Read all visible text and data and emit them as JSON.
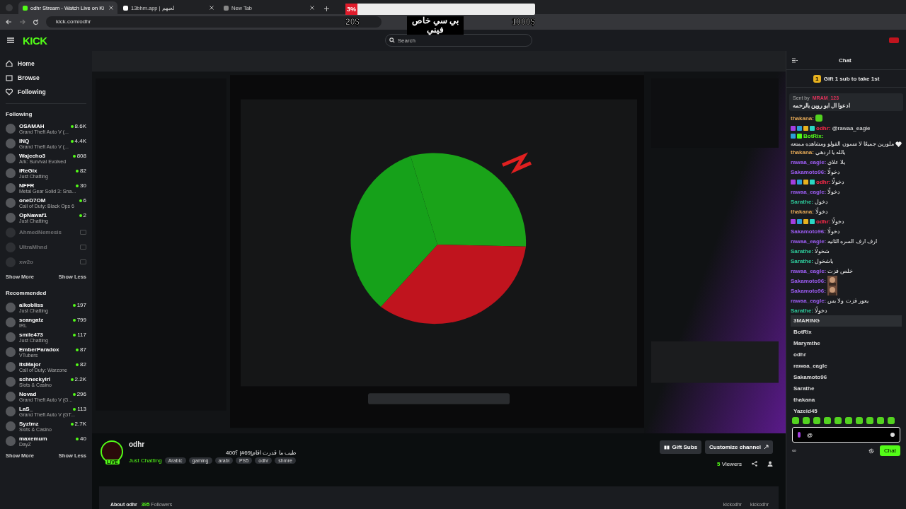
{
  "browser": {
    "tabs": [
      {
        "title": "odhr Stream - Watch Live on Ki",
        "selected": true,
        "kind": "kick"
      },
      {
        "title": "13bhm.app | لعبهم",
        "selected": false,
        "kind": "app"
      },
      {
        "title": "New Tab",
        "selected": false,
        "kind": "chrome"
      }
    ],
    "url": "kick.com/odhr"
  },
  "overlay": {
    "percent": "3%",
    "level": 0.03,
    "min": "20$",
    "max": "1000$",
    "caption": "بي سي خاص فيني"
  },
  "header": {
    "logo": "KICK",
    "search": {
      "placeholder": "Search"
    }
  },
  "sidebar": {
    "nav": [
      {
        "label": "Home",
        "kind": "home"
      },
      {
        "label": "Browse",
        "kind": "browse"
      },
      {
        "label": "Following",
        "kind": "heart"
      }
    ],
    "following_title": "Following",
    "following": [
      {
        "name": "OSAMAH",
        "game": "Grand Theft Auto V (...",
        "viewers": "8.6K",
        "live": true
      },
      {
        "name": "INQ",
        "game": "Grand Theft Auto V (...",
        "viewers": "4.4K",
        "live": true
      },
      {
        "name": "Wajeeho3",
        "game": "Ark: Survival Evolved",
        "viewers": "808",
        "live": true
      },
      {
        "name": "iReGix",
        "game": "Just Chatting",
        "viewers": "82",
        "live": true
      },
      {
        "name": "NFFR",
        "game": "Metal Gear Solid 3: Sna...",
        "viewers": "30",
        "live": true
      },
      {
        "name": "oneD7OM",
        "game": "Call of Duty: Black Ops 6",
        "viewers": "6",
        "live": true
      },
      {
        "name": "OpNawaf1",
        "game": "Just Chatting",
        "viewers": "2",
        "live": true
      },
      {
        "name": "AhmedNemesis",
        "live": false
      },
      {
        "name": "UltraMhnd",
        "live": false
      },
      {
        "name": "xw2o",
        "live": false
      }
    ],
    "show_more": "Show More",
    "show_less": "Show Less",
    "recommended_title": "Recommended",
    "recommended": [
      {
        "name": "aikobliss",
        "game": "Just Chatting",
        "viewers": "197",
        "live": true
      },
      {
        "name": "seangatz",
        "game": "IRL",
        "viewers": "799",
        "live": true
      },
      {
        "name": "smile473",
        "game": "Just Chatting",
        "viewers": "117",
        "live": true
      },
      {
        "name": "EmberParadox",
        "game": "VTubers",
        "viewers": "87",
        "live": true
      },
      {
        "name": "ItsMajor",
        "game": "Call of Duty: Warzone",
        "viewers": "82",
        "live": true
      },
      {
        "name": "schneckyirl",
        "game": "Slots & Casino",
        "viewers": "2.2K",
        "live": true
      },
      {
        "name": "Novad",
        "game": "Grand Theft Auto V (G...",
        "viewers": "296",
        "live": true
      },
      {
        "name": "LaS_",
        "game": "Grand Theft Auto V (GT...",
        "viewers": "113",
        "live": true
      },
      {
        "name": "Syztmz",
        "game": "Slots & Casino",
        "viewers": "2.7K",
        "live": true
      },
      {
        "name": "maxemum",
        "game": "DayZ",
        "viewers": "40",
        "live": true
      }
    ],
    "show_more_2": "Show More",
    "show_less_2": "Show Less"
  },
  "channel": {
    "name": "odhr",
    "live_badge": "LIVE",
    "title": "طيب ما قدرت اقام|69#| ؟400",
    "category": "Just Chatting",
    "tags": [
      "Arabic",
      "gaming",
      "arabi",
      "PS5",
      "odhr",
      "shmre"
    ],
    "gift_button": "Gift Subs",
    "customize_button": "Customize channel",
    "viewers": "5",
    "viewers_label": "Viewers",
    "about": "About odhr",
    "followers": "395",
    "followers_label": "Followers",
    "socials": [
      "kickodhr",
      "kickodhr"
    ]
  },
  "chat": {
    "title": "Chat",
    "goal": {
      "badge": "1",
      "text": "Gift 1 sub to take 1st"
    },
    "pinned": {
      "sent_by": "Sent by",
      "user": "MRAM_123",
      "color": "#e0325a",
      "text": "ادعوا ال ابو روين بالرحمه"
    },
    "messages": [
      {
        "user": "thakana:",
        "color": "#e3a857",
        "kind": "emote",
        "broadcaster": false,
        "bot": false
      },
      {
        "user": "odhr:",
        "color": "#ff2a4a",
        "kind": "text",
        "text": "@rawaa_eagle",
        "broadcaster": true,
        "bot": false
      },
      {
        "user": "BotRix:",
        "color": "#53fc18",
        "kind": "text",
        "text": "ملورين جميعًا لا تنسون الفولو ومشاهده ممتعه",
        "broadcaster": false,
        "bot": true,
        "heart": true
      },
      {
        "user": "thakana:",
        "color": "#e3a857",
        "kind": "text",
        "text": "يالله يا اردهي",
        "broadcaster": false,
        "bot": false
      },
      {
        "user": "rawaa_eagle:",
        "color": "#9b5cf0",
        "kind": "text",
        "text": "يلا علاي",
        "broadcaster": false,
        "bot": false
      },
      {
        "user": "Sakamoto96:",
        "color": "#9b5cf0",
        "kind": "text",
        "text": "دخولًا",
        "broadcaster": false,
        "bot": false
      },
      {
        "user": "odhr:",
        "color": "#ff2a4a",
        "kind": "text",
        "text": "دخولًا",
        "broadcaster": true,
        "bot": false
      },
      {
        "user": "rawaa_eagle:",
        "color": "#9b5cf0",
        "kind": "text",
        "text": "دخولًا",
        "broadcaster": false,
        "bot": false
      },
      {
        "user": "Sarathe:",
        "color": "#2ec99a",
        "kind": "text",
        "text": "دخول",
        "broadcaster": false,
        "bot": false
      },
      {
        "user": "thakana:",
        "color": "#e3a857",
        "kind": "text",
        "text": "دخولًا",
        "broadcaster": false,
        "bot": false
      },
      {
        "user": "odhr:",
        "color": "#ff2a4a",
        "kind": "text",
        "text": "دخولًا",
        "broadcaster": true,
        "bot": false
      },
      {
        "user": "Sakamoto96:",
        "color": "#9b5cf0",
        "kind": "text",
        "text": "دخولًا",
        "broadcaster": false,
        "bot": false
      },
      {
        "user": "rawaa_eagle:",
        "color": "#9b5cf0",
        "kind": "text",
        "text": "ارف ارف السره الثانيه",
        "broadcaster": false,
        "bot": false
      },
      {
        "user": "Sarathe:",
        "color": "#2ec99a",
        "kind": "text",
        "text": "شخولًا",
        "broadcaster": false,
        "bot": false
      },
      {
        "user": "Sarathe:",
        "color": "#2ec99a",
        "kind": "text",
        "text": "ياشخول",
        "broadcaster": false,
        "bot": false
      },
      {
        "user": "rawaa_eagle:",
        "color": "#9b5cf0",
        "kind": "text",
        "text": "خلص فزت",
        "broadcaster": false,
        "bot": false
      },
      {
        "user": "Sakamoto96:",
        "color": "#9b5cf0",
        "kind": "picture",
        "broadcaster": false,
        "bot": false
      },
      {
        "user": "Sakamoto96:",
        "color": "#9b5cf0",
        "kind": "picture",
        "broadcaster": false,
        "bot": false
      },
      {
        "user": "rawaa_eagle:",
        "color": "#9b5cf0",
        "kind": "text",
        "text": "يعور فزت ولا بس",
        "broadcaster": false,
        "bot": false
      },
      {
        "user": "Sarathe:",
        "color": "#2ec99a",
        "kind": "text",
        "text": "دخولًا",
        "broadcaster": false,
        "bot": false
      }
    ],
    "mentions": [
      {
        "name": "3MARING",
        "selected": true
      },
      {
        "name": "BotRix",
        "selected": false
      },
      {
        "name": "Marymthe",
        "selected": false
      },
      {
        "name": "odhr",
        "selected": false
      },
      {
        "name": "rawaa_eagle",
        "selected": false
      },
      {
        "name": "Sakamoto96",
        "selected": false
      },
      {
        "name": "Sarathe",
        "selected": false
      },
      {
        "name": "thakana",
        "selected": false
      },
      {
        "name": "Yazeid45",
        "selected": false
      }
    ],
    "input_value": "@",
    "points": "∞",
    "send_button": "Chat"
  }
}
